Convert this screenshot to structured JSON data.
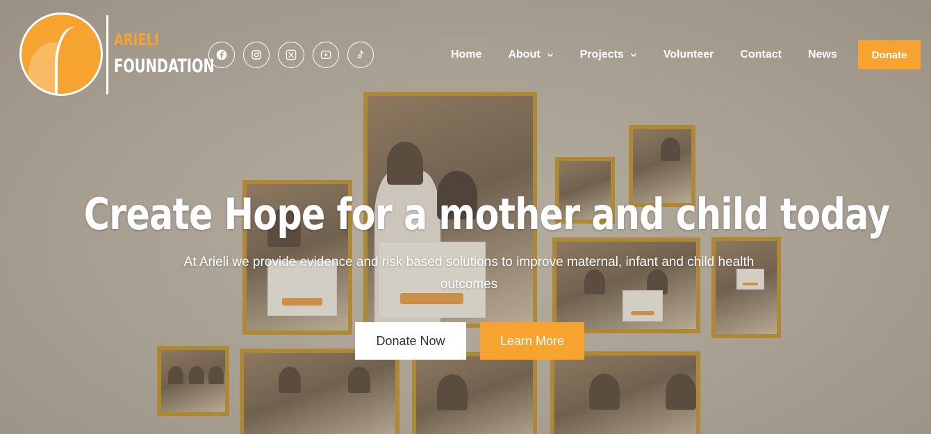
{
  "header": {
    "logo_line1": "ARIELI",
    "logo_line2": "FOUNDATION",
    "socials": [
      {
        "icon": "facebook-icon"
      },
      {
        "icon": "instagram-icon"
      },
      {
        "icon": "x-twitter-icon"
      },
      {
        "icon": "youtube-icon"
      },
      {
        "icon": "tiktok-icon"
      }
    ],
    "nav": [
      {
        "label": "Home",
        "has_dropdown": false
      },
      {
        "label": "About",
        "has_dropdown": true
      },
      {
        "label": "Projects",
        "has_dropdown": true
      },
      {
        "label": "Volunteer",
        "has_dropdown": false
      },
      {
        "label": "Contact",
        "has_dropdown": false
      },
      {
        "label": "News",
        "has_dropdown": false
      }
    ],
    "donate_label": "Donate"
  },
  "hero": {
    "title": "Create Hope for a mother and child today",
    "subtitle": "At Arieli we provide evidence and risk based solutions to improve maternal, infant and child health outcomes",
    "primary_button": "Donate Now",
    "secondary_button": "Learn More"
  },
  "colors": {
    "accent": "#f7a330",
    "photo_frame": "#b88612",
    "text_on_hero": "#ffffff"
  }
}
